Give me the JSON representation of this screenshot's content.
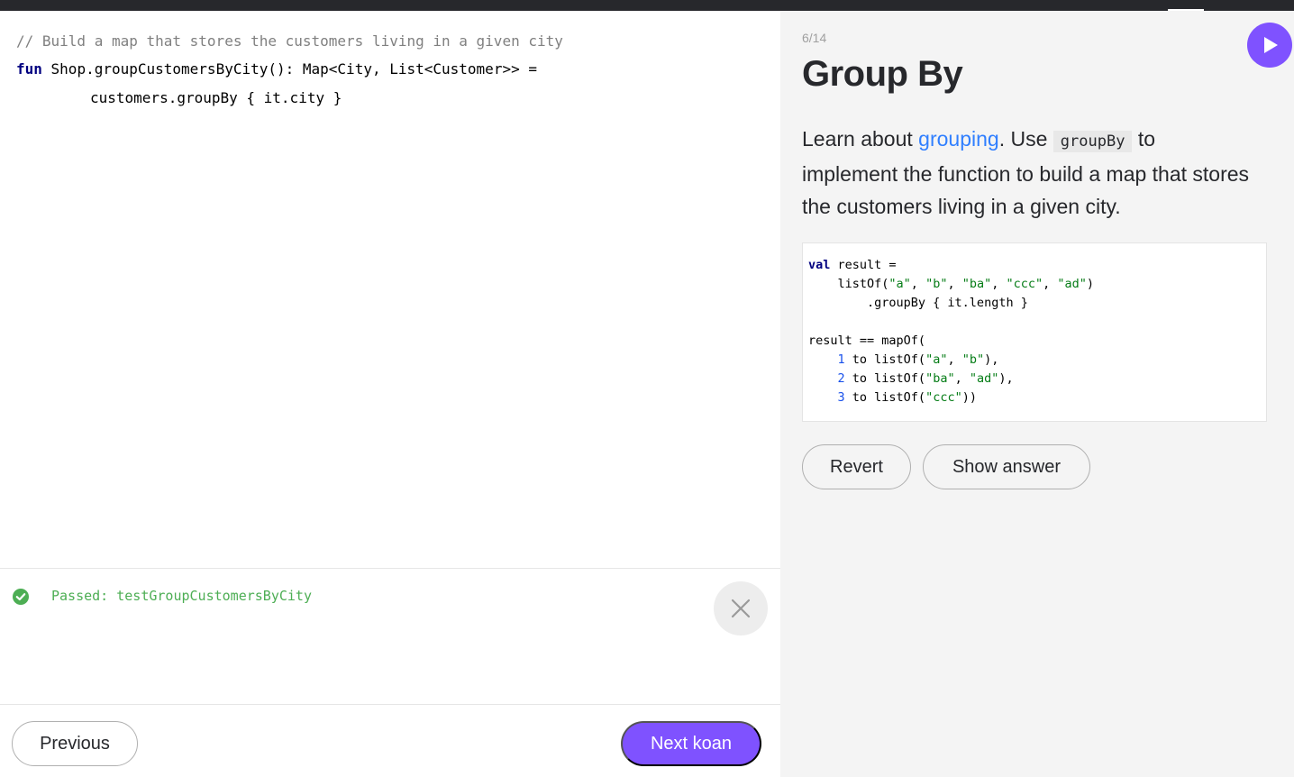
{
  "editor": {
    "lines": [
      "// Build a map that stores the customers living in a given city",
      "fun",
      " Shop.groupCustomersByCity(): Map<City, List<Customer>> =",
      "customers.groupBy { it.city }"
    ]
  },
  "output": {
    "status": "Passed: testGroupCustomersByCity"
  },
  "footer": {
    "previous_label": "Previous",
    "next_label": "Next koan"
  },
  "panel": {
    "progress": "6/14",
    "title": "Group By",
    "desc": {
      "prefix": "Learn about ",
      "link": "grouping",
      "mid": ". Use ",
      "code": "groupBy",
      "suffix": " to implement the function to build a map that stores the customers living in a given city."
    },
    "sample": {
      "l1_kw": "val",
      "l1_rest": " result =",
      "l2_a": "    listOf(",
      "l2_s1": "\"a\"",
      "l2_c1": ", ",
      "l2_s2": "\"b\"",
      "l2_c2": ", ",
      "l2_s3": "\"ba\"",
      "l2_c3": ", ",
      "l2_s4": "\"ccc\"",
      "l2_c4": ", ",
      "l2_s5": "\"ad\"",
      "l2_end": ")",
      "l3": "        .groupBy { it.length }",
      "l5": "result == mapOf(",
      "l6_n": "1",
      "l6_a": " to listOf(",
      "l6_s1": "\"a\"",
      "l6_c": ", ",
      "l6_s2": "\"b\"",
      "l6_end": "),",
      "l7_n": "2",
      "l7_a": " to listOf(",
      "l7_s1": "\"ba\"",
      "l7_c": ", ",
      "l7_s2": "\"ad\"",
      "l7_end": "),",
      "l8_n": "3",
      "l8_a": " to listOf(",
      "l8_s1": "\"ccc\"",
      "l8_end": "))"
    },
    "revert_label": "Revert",
    "answer_label": "Show answer"
  },
  "icons": {
    "run": "play-icon",
    "status": "check-circle-icon",
    "close": "close-icon"
  },
  "colors": {
    "accent": "#7f52ff",
    "link": "#307fff",
    "success": "#4dae54"
  }
}
